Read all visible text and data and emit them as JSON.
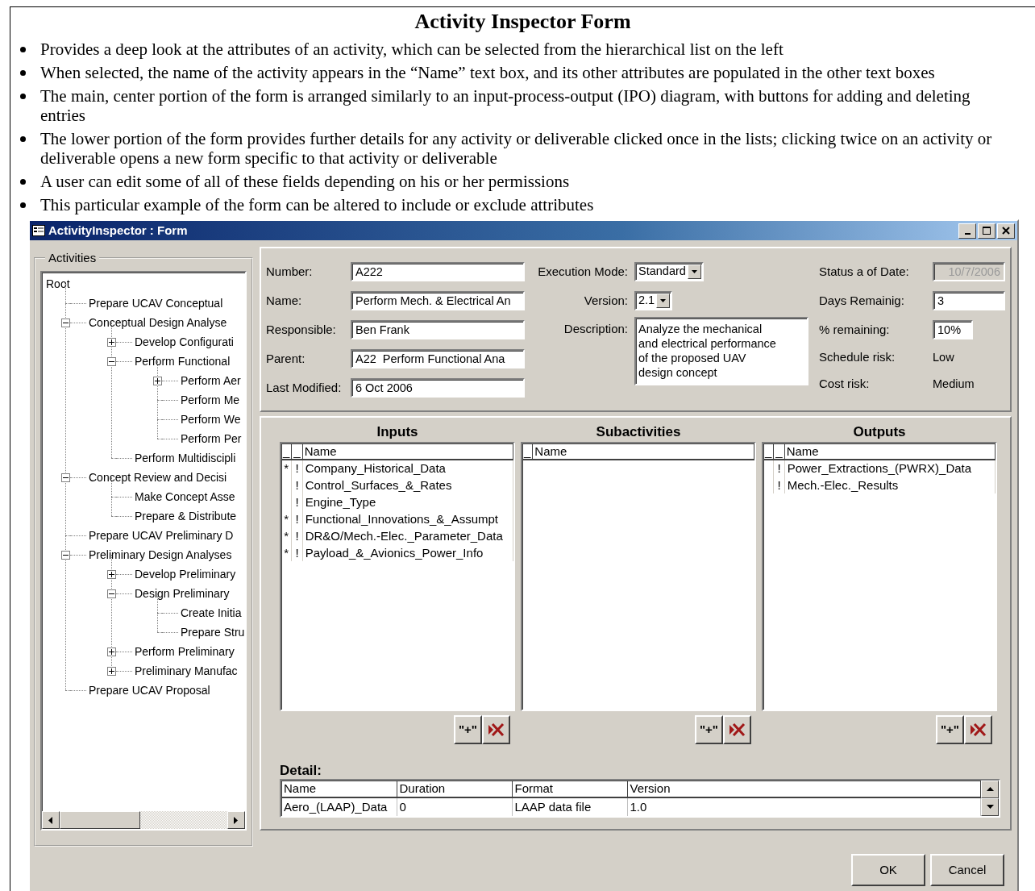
{
  "document": {
    "title": "Activity Inspector Form",
    "bullets": [
      "Provides a deep look at the attributes of an activity, which can be selected from the hierarchical list on the left",
      "When selected, the name of the activity appears in the “Name” text box, and its other attributes are populated in the other text boxes",
      "The main, center portion of the form is arranged similarly to an input-process-output (IPO) diagram, with buttons for adding and deleting entries",
      "The lower portion of the form provides further details for any activity or deliverable clicked once in the lists; clicking twice on an activity or deliverable opens a new form specific to that activity or deliverable",
      "A user can edit some of all of these fields depending on his or her permissions",
      "This particular example of the form can be altered to include or exclude attributes"
    ]
  },
  "window": {
    "title": "ActivityInspector : Form"
  },
  "activities": {
    "legend": "Activities",
    "tree": {
      "label": "Root",
      "children": [
        {
          "label": "Prepare UCAV Conceptual"
        },
        {
          "label": "Conceptual Design Analyse",
          "expanded": true,
          "children": [
            {
              "label": "Develop Configurati",
              "expanded": false
            },
            {
              "label": "Perform Functional",
              "expanded": true,
              "children": [
                {
                  "label": "Perform Aer",
                  "expanded": false
                },
                {
                  "label": "Perform Me"
                },
                {
                  "label": "Perform We"
                },
                {
                  "label": "Perform Per"
                }
              ]
            },
            {
              "label": "Perform Multidiscipli"
            }
          ]
        },
        {
          "label": "Concept Review and Decisi",
          "expanded": true,
          "children": [
            {
              "label": "Make Concept Asse"
            },
            {
              "label": "Prepare & Distribute"
            }
          ]
        },
        {
          "label": "Prepare UCAV Preliminary D"
        },
        {
          "label": "Preliminary Design Analyses",
          "expanded": true,
          "children": [
            {
              "label": "Develop Preliminary",
              "expanded": false
            },
            {
              "label": "Design Preliminary",
              "expanded": true,
              "children": [
                {
                  "label": "Create Initia"
                },
                {
                  "label": "Prepare Stru"
                }
              ]
            },
            {
              "label": "Perform Preliminary",
              "expanded": false
            },
            {
              "label": "Preliminary Manufac",
              "expanded": false
            }
          ]
        },
        {
          "label": "Prepare UCAV Proposal"
        }
      ]
    }
  },
  "general": [
    {
      "label": "Number:",
      "value": "A222"
    },
    {
      "label": "Name:",
      "value": "Perform Mech. & Electrical An"
    },
    {
      "label": "Responsible:",
      "value": "Ben Frank"
    },
    {
      "label": "Parent:",
      "value": "A22  Perform Functional Ana"
    },
    {
      "label": "Last Modified:",
      "value": "6 Oct 2006"
    }
  ],
  "execution_mode": {
    "label": "Execution Mode:",
    "value": "Standard"
  },
  "version": {
    "label": "Version:",
    "value": "2.1"
  },
  "description": {
    "label": "Description:",
    "lines": [
      "Analyze the mechanical",
      "and electrical performance",
      "of the proposed UAV",
      "design concept"
    ]
  },
  "status": [
    {
      "label": "Status a of Date:",
      "value": "10/7/2006",
      "kind": "field",
      "disabled": true
    },
    {
      "label": "Days Remainig:",
      "value": "3",
      "kind": "field",
      "disabled": false
    },
    {
      "label": "% remaining:",
      "value": "10%",
      "kind": "short-field",
      "disabled": false
    },
    {
      "label": "Schedule risk:",
      "value": "Low",
      "kind": "text",
      "disabled": false
    },
    {
      "label": "Cost risk:",
      "value": "Medium",
      "kind": "text",
      "disabled": false
    }
  ],
  "panels": [
    {
      "title": "Inputs",
      "columns": [
        "_",
        "_",
        "Name"
      ],
      "add_label": "\"+\"",
      "rows": [
        {
          "mark_1": "*",
          "mark_2": "!",
          "name": "Company_Historical_Data"
        },
        {
          "mark_2": "!",
          "name": "Control_Surfaces_&_Rates"
        },
        {
          "mark_2": "!",
          "name": "Engine_Type"
        },
        {
          "mark_1": "*",
          "mark_2": "!",
          "name": "Functional_Innovations_&_Assumpt"
        },
        {
          "mark_1": "*",
          "mark_2": "!",
          "name": "DR&O/Mech.-Elec._Parameter_Data"
        },
        {
          "mark_1": "*",
          "mark_2": "!",
          "name": "Payload_&_Avionics_Power_Info"
        }
      ]
    },
    {
      "title": "Subactivities",
      "columns": [
        "_",
        "Name"
      ],
      "add_label": "\"+\""
    },
    {
      "title": "Outputs",
      "columns": [
        "_",
        "_",
        "Name"
      ],
      "add_label": "\"+\"",
      "rows": [
        {
          "mark_2": "!",
          "name": "Power_Extractions_(PWRX)_Data"
        },
        {
          "mark_2": "!",
          "name": "Mech.-Elec._Results"
        }
      ]
    }
  ],
  "detail": {
    "title": "Detail:",
    "columns": [
      "Name",
      "Duration",
      "Format",
      "Version"
    ],
    "rows": [
      [
        "Aero_(LAAP)_Data",
        "0",
        "LAAP data file",
        "1.0"
      ]
    ]
  },
  "dialog_buttons": [
    "OK",
    "Cancel"
  ]
}
